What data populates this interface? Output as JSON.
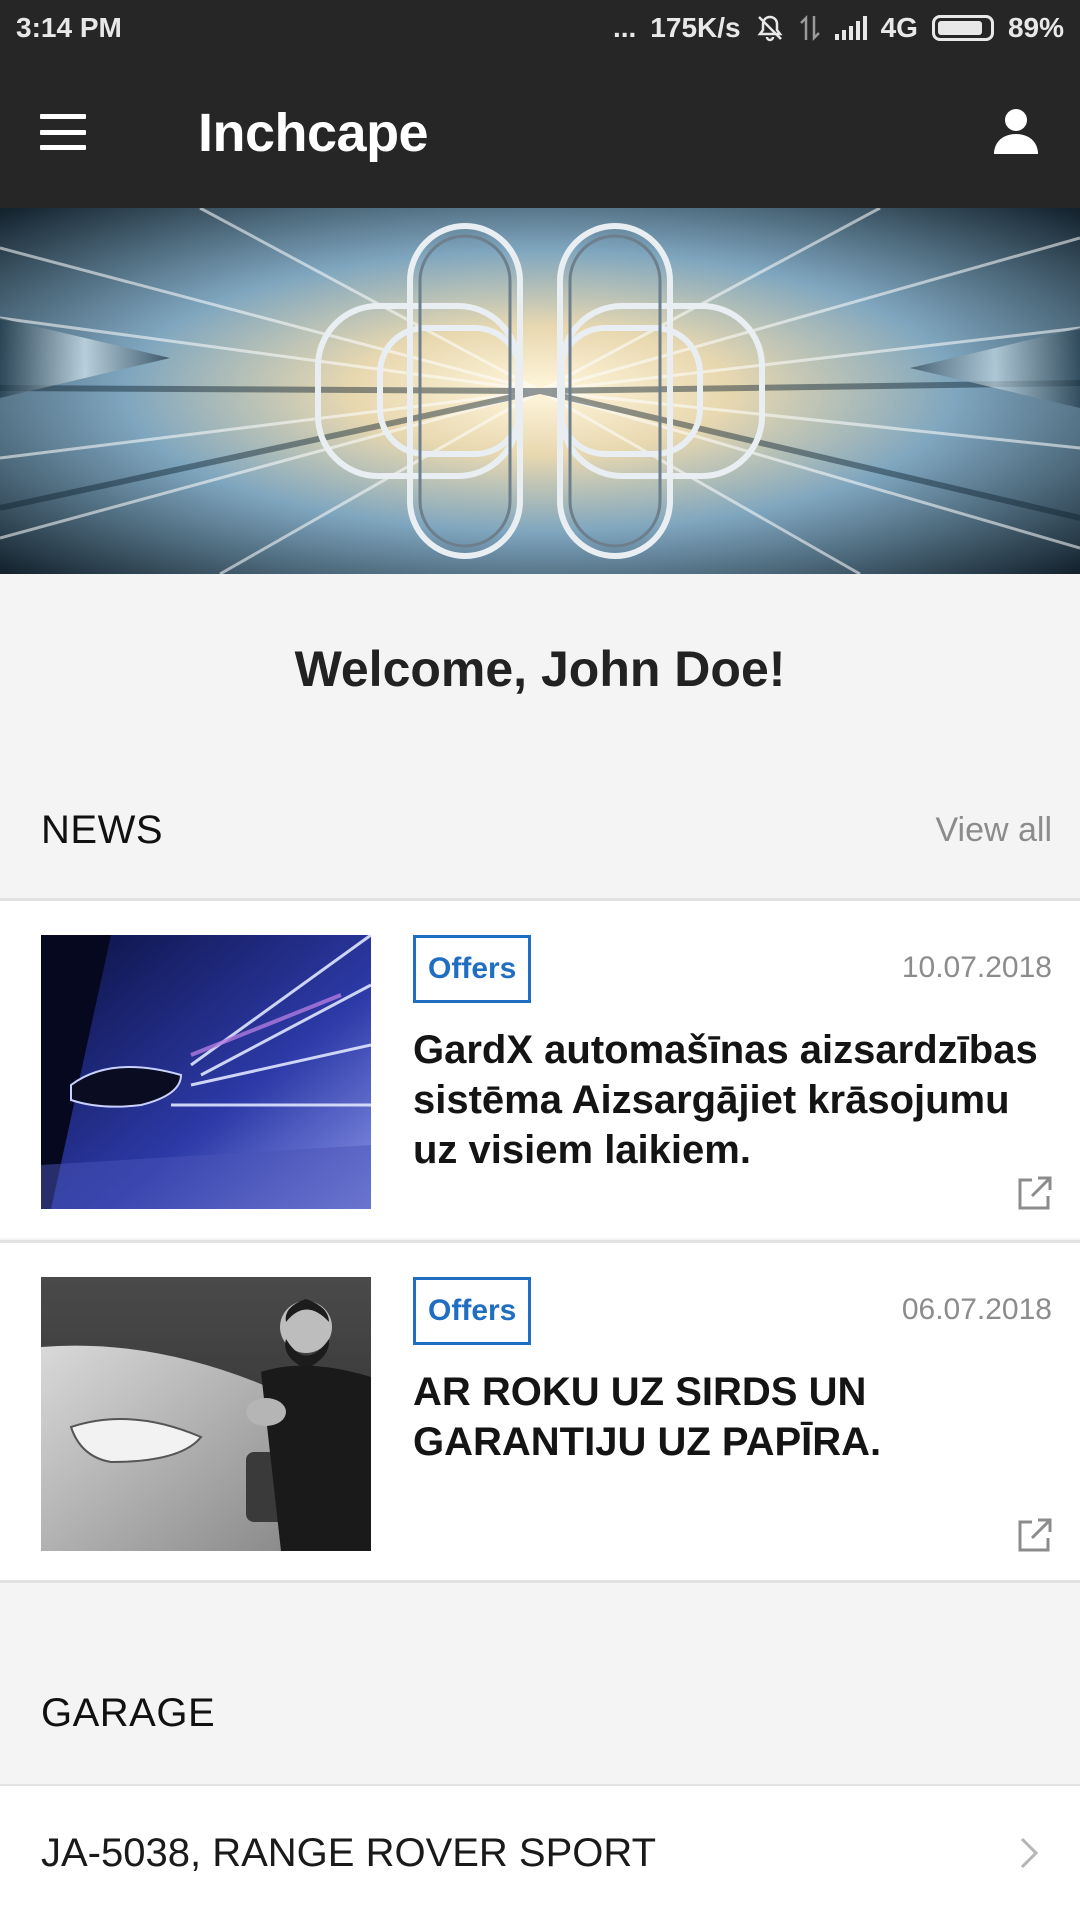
{
  "status_bar": {
    "time": "3:14 PM",
    "dots": "...",
    "net_speed": "175K/s",
    "network": "4G",
    "battery": "89%",
    "battery_level": 0.89,
    "icons": [
      "mute-icon",
      "data-transfer-icon",
      "signal-icon",
      "battery-icon"
    ]
  },
  "app_bar": {
    "title": "Inchcape",
    "icons": [
      "hamburger-menu-icon",
      "user-profile-icon"
    ]
  },
  "welcome": "Welcome, John Doe!",
  "news": {
    "title": "NEWS",
    "view_all": "View all",
    "items": [
      {
        "tag": "Offers",
        "date": "10.07.2018",
        "title": "GardX automašīnas aizsardzības sistēma Aizsargājiet krāsojumu uz visiem laikiem.",
        "image": "speeding-car-photo"
      },
      {
        "tag": "Offers",
        "date": "06.07.2018",
        "title": "AR ROKU UZ SIRDS UN GARANTIJU UZ PAPĪRA.",
        "image": "man-with-car-photo"
      }
    ]
  },
  "garage": {
    "title": "GARAGE",
    "items": [
      {
        "label": "JA-5038, RANGE ROVER SPORT"
      }
    ]
  },
  "colors": {
    "bar_bg": "#262626",
    "accent_blue": "#1f6ec2",
    "page_bg": "#f4f4f4",
    "muted_text": "#8c8c8c"
  }
}
